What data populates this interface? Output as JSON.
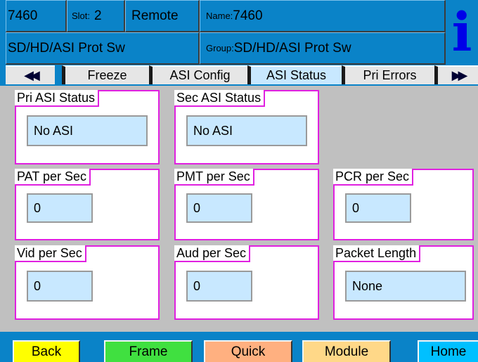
{
  "header": {
    "model": "7460",
    "slot_label": "Slot:",
    "slot_value": "2",
    "mode": "Remote",
    "name_label": "Name:",
    "name_value": "7460",
    "product": "SD/HD/ASI Prot Sw",
    "group_label": "Group:",
    "group_value": "SD/HD/ASI Prot Sw",
    "info_icon_glyph": "i"
  },
  "tabs": {
    "prev_glyph": "◀◀",
    "next_glyph": "▶▶",
    "items": [
      {
        "label": "Freeze",
        "active": false
      },
      {
        "label": "ASI Config",
        "active": false
      },
      {
        "label": "ASI Status",
        "active": true
      },
      {
        "label": "Pri Errors",
        "active": false
      }
    ]
  },
  "status": {
    "pri_asi": {
      "label": "Pri ASI Status",
      "value": "No ASI"
    },
    "sec_asi": {
      "label": "Sec ASI Status",
      "value": "No ASI"
    },
    "pat": {
      "label": "PAT per Sec",
      "value": "0"
    },
    "pmt": {
      "label": "PMT per Sec",
      "value": "0"
    },
    "pcr": {
      "label": "PCR per Sec",
      "value": "0"
    },
    "vid": {
      "label": "Vid per Sec",
      "value": "0"
    },
    "aud": {
      "label": "Aud per Sec",
      "value": "0"
    },
    "packet_length": {
      "label": "Packet Length",
      "value": "None"
    }
  },
  "buttons": {
    "back": {
      "label": "Back",
      "color": "#ffff00"
    },
    "frame": {
      "label": "Frame",
      "color": "#40e040"
    },
    "quick": {
      "label": "Quick",
      "color": "#ffb080"
    },
    "module": {
      "label": "Module",
      "color": "#ffd888"
    },
    "home": {
      "label": "Home",
      "color": "#00c0ff"
    }
  },
  "colors": {
    "header_blue": "#0a83c8",
    "group_border": "#e020e0",
    "value_field": "#c8e8ff",
    "active_tab": "#c8e8ff",
    "panel_bg": "#c0c0c0"
  }
}
